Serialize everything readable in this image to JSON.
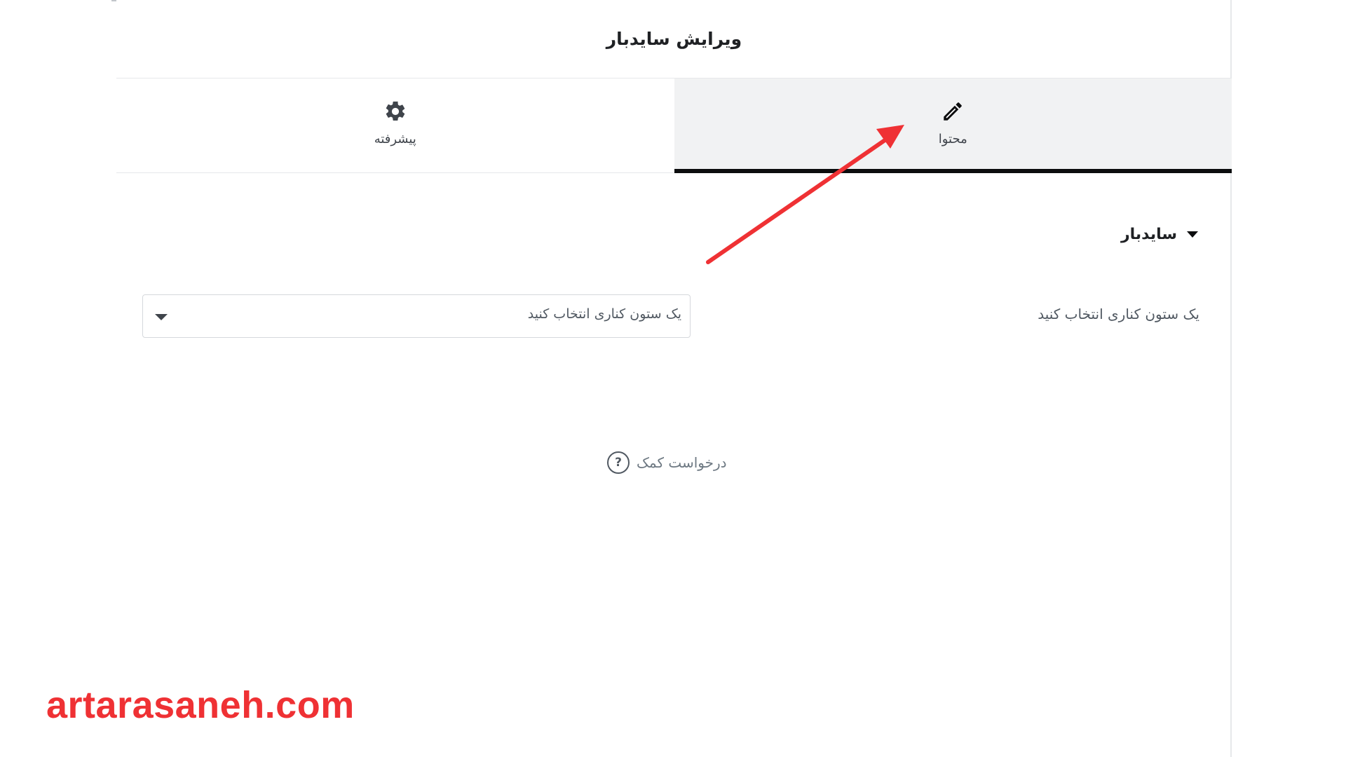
{
  "header": {
    "title": "ویرایش سایدبار"
  },
  "tabs": [
    {
      "label": "محتوا",
      "icon": "pencil-icon",
      "active": true
    },
    {
      "label": "پیشرفته",
      "icon": "gear-icon",
      "active": false
    }
  ],
  "section": {
    "title": "سایدبار",
    "expanded": true
  },
  "control": {
    "label": "یک ستون کناری انتخاب کنید",
    "select_value": "یک ستون کناری انتخاب کنید"
  },
  "help": {
    "label": "درخواست کمک",
    "icon": "question-circle-icon"
  },
  "annotation": {
    "arrow_color": "#ef3134"
  },
  "watermark": {
    "text": "artarasaneh.com",
    "color": "#ef3134"
  }
}
